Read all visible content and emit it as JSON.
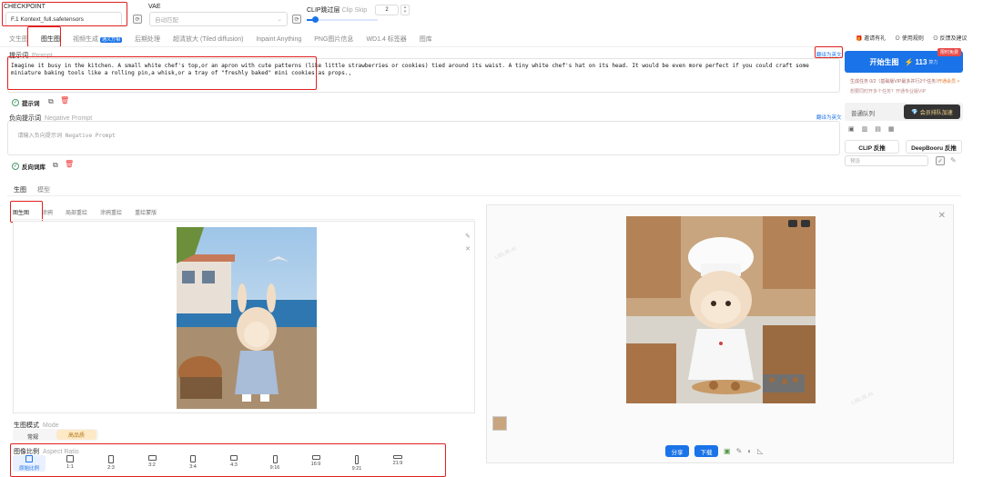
{
  "top": {
    "checkpoint_label": "CHECKPOINT",
    "checkpoint_value": "F.1 Kontext_full.safetensors",
    "vae_label": "VAE",
    "vae_value": "自动匹配",
    "clip_label": "CLIP跳过层",
    "clip_sub": "Clip Skip",
    "clip_value": "2"
  },
  "main_tabs": [
    "文生图",
    "图生图",
    "视频生成",
    "后期处理",
    "超清放大 (Tiled diffusion)",
    "Inpaint Anything",
    "PNG图片信息",
    "WD1.4 标签器",
    "图库"
  ],
  "main_tab_badge": "通义万相",
  "prompt": {
    "label": "提示词",
    "sub": "Prompt",
    "translate": "翻译为英文",
    "text": "Imagine it busy in the kitchen. A small white chef's top,or an apron with cute patterns (like little strawberries or cookies) tied around its waist. A tiny white chef's hat on its head. It would be even more perfect if you could craft some miniature baking tools like a rolling pin,a whisk,or a tray of \"freshly baked\" mini cookies as props.,",
    "tags_label": "提示词"
  },
  "negative": {
    "label": "负向提示词",
    "sub": "Negative Prompt",
    "translate": "翻译为英文",
    "placeholder": "请输入负向提示词 Negative Prompt",
    "tags_label": "反向词库"
  },
  "right": {
    "links": [
      "邀请有礼",
      "使用规则",
      "反馈及建议"
    ],
    "limited_badge": "限时免费",
    "generate_label": "开始生图",
    "cost": "113",
    "cost_unit": "算力",
    "task_text": "生成任务 0/2（基础版VIP最多并行2个任务）",
    "task_link": "开通会员 >",
    "sub_text": "想要同时开多个任务？开通专业版VIP",
    "queue_normal": "普通队列",
    "queue_vip": "会员排队加速",
    "clip_btn": "CLIP 反推",
    "deepbooru_btn": "DeepBooru 反推",
    "preset_placeholder": "预设"
  },
  "sub_tabs": [
    "生图",
    "模型"
  ],
  "img_tabs": [
    "图生图",
    "涂鸦",
    "局部重绘",
    "涂鸦重绘",
    "重绘蒙版"
  ],
  "mode": {
    "label": "生图模式",
    "sub": "Mode",
    "options": [
      "常规",
      "高品质"
    ]
  },
  "ratio": {
    "label": "图像比例",
    "sub": "Aspect Ratio",
    "options": [
      "原始比例",
      "1:1",
      "2:3",
      "3:2",
      "3:4",
      "4:3",
      "9:16",
      "16:9",
      "9:21",
      "21:9"
    ]
  },
  "result_actions": {
    "share": "分享",
    "download": "下载"
  },
  "watermark": "LIBLIB.AI"
}
